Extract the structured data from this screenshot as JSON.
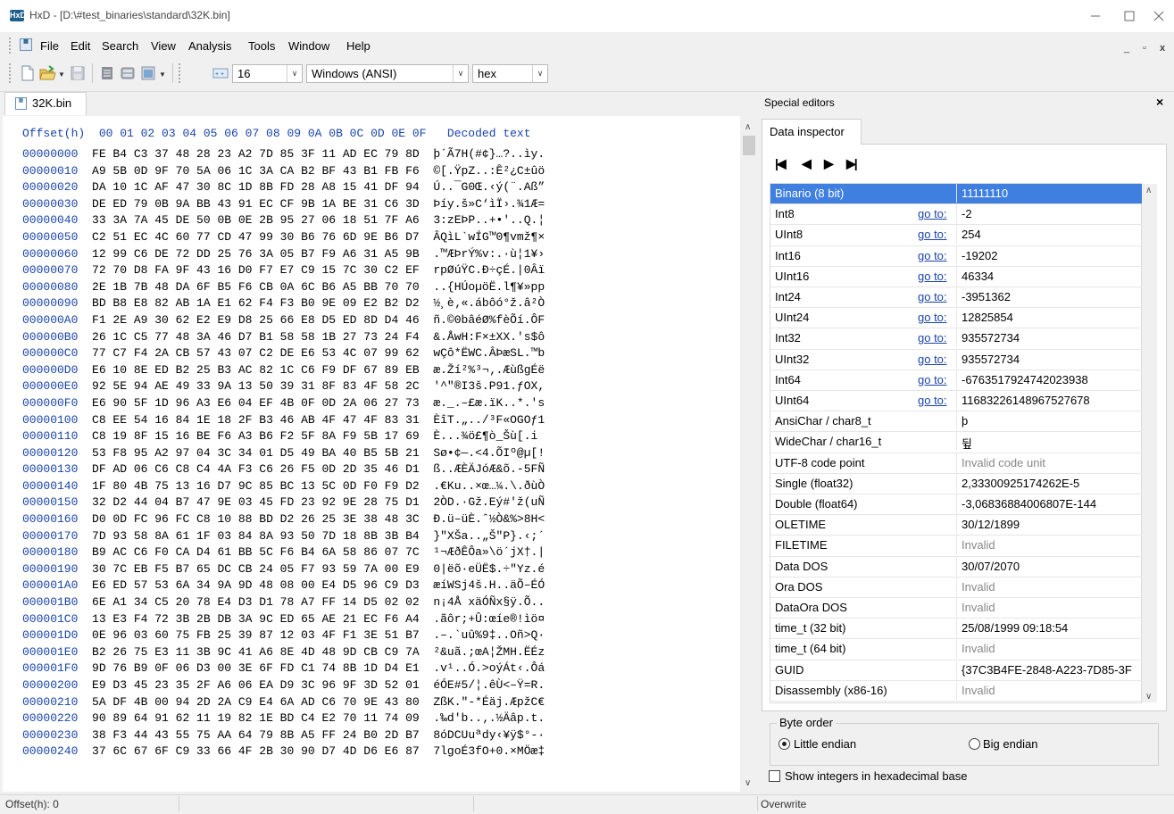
{
  "window": {
    "logo": "HxD",
    "title": "HxD - [D:\\#test_binaries\\standard\\32K.bin]",
    "controls": [
      "minimize-icon",
      "maximize-icon",
      "close-icon"
    ]
  },
  "menu": {
    "items": [
      "File",
      "Edit",
      "Search",
      "View",
      "Analysis",
      "Tools",
      "Window",
      "Help"
    ],
    "mdi_controls": [
      "_",
      "▫",
      "x"
    ]
  },
  "toolbar": {
    "icons": [
      "new-file-icon",
      "open-file-icon",
      "save-icon",
      "hex-view-icon",
      "database-icon",
      "windows-icon",
      "offset-base-icon"
    ],
    "bytes_per_row": "16",
    "charset": "Windows (ANSI)",
    "offset_base": "hex"
  },
  "document_tab": {
    "label": "32K.bin"
  },
  "hex": {
    "header_offset": "Offset(h)",
    "header_columns": "00 01 02 03 04 05 06 07 08 09 0A 0B 0C 0D 0E 0F",
    "header_decoded": "Decoded text",
    "rows": [
      {
        "offset": "00000000",
        "bytes": "FE B4 C3 37 48 28 23 A2 7D 85 3F 11 AD EC 79 8D",
        "text": "þ´Ã7H(#¢}…?..ìy."
      },
      {
        "offset": "00000010",
        "bytes": "A9 5B 0D 9F 70 5A 06 1C 3A CA B2 BF 43 B1 FB F6",
        "text": "©[.ŸpZ..:Ê²¿C±ûö"
      },
      {
        "offset": "00000020",
        "bytes": "DA 10 1C AF 47 30 8C 1D 8B FD 28 A8 15 41 DF 94",
        "text": "Ú..¯G0Œ.‹ý(¨.Aß”"
      },
      {
        "offset": "00000030",
        "bytes": "DE ED 79 0B 9A BB 43 91 EC CF 9B 1A BE 31 C6 3D",
        "text": "Þíy.š»C‘ìÏ›.¾1Æ="
      },
      {
        "offset": "00000040",
        "bytes": "33 3A 7A 45 DE 50 0B 0E 2B 95 27 06 18 51 7F A6",
        "text": "3:zEÞP..+•'..Q.¦"
      },
      {
        "offset": "00000050",
        "bytes": "C2 51 EC 4C 60 77 CD 47 99 30 B6 76 6D 9E B6 D7",
        "text": "ÂQìL`wÍG™0¶vmž¶×"
      },
      {
        "offset": "00000060",
        "bytes": "12 99 C6 DE 72 DD 25 76 3A 05 B7 F9 A6 31 A5 9B",
        "text": ".™ÆÞrÝ%v:.·ù¦1¥›"
      },
      {
        "offset": "00000070",
        "bytes": "72 70 D8 FA 9F 43 16 D0 F7 E7 C9 15 7C 30 C2 EF",
        "text": "rpØúŸC.Ð÷çÉ.|0Âï"
      },
      {
        "offset": "00000080",
        "bytes": "2E 1B 7B 48 DA 6F B5 F6 CB 0A 6C B6 A5 BB 70 70",
        "text": "..{HÚoµöË.l¶¥»pp"
      },
      {
        "offset": "00000090",
        "bytes": "BD B8 E8 82 AB 1A E1 62 F4 F3 B0 9E 09 E2 B2 D2",
        "text": "½¸è‚«.ábôó°ž.â²Ò"
      },
      {
        "offset": "000000A0",
        "bytes": "F1 2E A9 30 62 E2 E9 D8 25 66 E8 D5 ED 8D D4 46",
        "text": "ñ.©0bâéØ%fèÕí.ÔF"
      },
      {
        "offset": "000000B0",
        "bytes": "26 1C C5 77 48 3A 46 D7 B1 58 58 1B 27 73 24 F4",
        "text": "&.ÅwH:F×±XX.'s$ô"
      },
      {
        "offset": "000000C0",
        "bytes": "77 C7 F4 2A CB 57 43 07 C2 DE E6 53 4C 07 99 62",
        "text": "wÇô*ËWC.ÂÞæSL.™b"
      },
      {
        "offset": "000000D0",
        "bytes": "E6 10 8E ED B2 25 B3 AC 82 1C C6 F9 DF 67 89 EB",
        "text": "æ.Ží²%³¬‚.ÆùßgÉë"
      },
      {
        "offset": "000000E0",
        "bytes": "92 5E 94 AE 49 33 9A 13 50 39 31 8F 83 4F 58 2C",
        "text": "'^\"®I3š.P91.ƒOX,"
      },
      {
        "offset": "000000F0",
        "bytes": "E6 90 5F 1D 96 A3 E6 04 EF 4B 0F 0D 2A 06 27 73",
        "text": "æ._.–£æ.ïK..*.'s"
      },
      {
        "offset": "00000100",
        "bytes": "C8 EE 54 16 84 1E 18 2F B3 46 AB 4F 47 4F 83 31",
        "text": "ÈîT.„../³F«OGOƒ1"
      },
      {
        "offset": "00000110",
        "bytes": "C8 19 8F 15 16 BE F6 A3 B6 F2 5F 8A F9 5B 17 69",
        "text": "È...¾ö£¶ò_Šù[.i"
      },
      {
        "offset": "00000120",
        "bytes": "53 F8 95 A2 97 04 3C 34 01 D5 49 BA 40 B5 5B 21",
        "text": "Sø•¢—.<4.ÕIº@µ[!"
      },
      {
        "offset": "00000130",
        "bytes": "DF AD 06 C6 C8 C4 4A F3 C6 26 F5 0D 2D 35 46 D1",
        "text": "ß..ÆÈÄJóÆ&õ.-5FÑ"
      },
      {
        "offset": "00000140",
        "bytes": "1F 80 4B 75 13 16 D7 9C 85 BC 13 5C 0D F0 F9 D2",
        "text": ".€Ku..×œ…¼.\\.ðùÒ"
      },
      {
        "offset": "00000150",
        "bytes": "32 D2 44 04 B7 47 9E 03 45 FD 23 92 9E 28 75 D1",
        "text": "2ÒD.·Gž.Eý#'ž(uÑ"
      },
      {
        "offset": "00000160",
        "bytes": "D0 0D FC 96 FC C8 10 88 BD D2 26 25 3E 38 48 3C",
        "text": "Ð.ü–üÈ.ˆ½Ò&%>8H<"
      },
      {
        "offset": "00000170",
        "bytes": "7D 93 58 8A 61 1F 03 84 8A 93 50 7D 18 8B 3B B4",
        "text": "}\"XŠa..„Š\"P}.‹;´"
      },
      {
        "offset": "00000180",
        "bytes": "B9 AC C6 F0 CA D4 61 BB 5C F6 B4 6A 58 86 07 7C",
        "text": "¹¬ÆðÊÔa»\\ö´jX†.|"
      },
      {
        "offset": "00000190",
        "bytes": "30 7C EB F5 B7 65 DC CB 24 05 F7 93 59 7A 00 E9",
        "text": "0|ëõ·eÜË$.÷\"Yz.é"
      },
      {
        "offset": "000001A0",
        "bytes": "E6 ED 57 53 6A 34 9A 9D 48 08 00 E4 D5 96 C9 D3",
        "text": "æíWSj4š.H..äÕ–ÉÓ"
      },
      {
        "offset": "000001B0",
        "bytes": "6E A1 34 C5 20 78 E4 D3 D1 78 A7 FF 14 D5 02 02",
        "text": "n¡4Å xäÓÑx§ÿ.Õ.."
      },
      {
        "offset": "000001C0",
        "bytes": "13 E3 F4 72 3B 2B DB 3A 9C ED 65 AE 21 EC F6 A4",
        "text": ".ãôr;+Û:œíe®!ìö¤"
      },
      {
        "offset": "000001D0",
        "bytes": "0E 96 03 60 75 FB 25 39 87 12 03 4F F1 3E 51 B7",
        "text": ".–.`uû%9‡..Oñ>Q·"
      },
      {
        "offset": "000001E0",
        "bytes": "B2 26 75 E3 11 3B 9C 41 A6 8E 4D 48 9D CB C9 7A",
        "text": "²&uã.;œA¦ŽMH.ËÉz"
      },
      {
        "offset": "000001F0",
        "bytes": "9D 76 B9 0F 06 D3 00 3E 6F FD C1 74 8B 1D D4 E1",
        "text": ".v¹..Ó.>oýÁt‹.Ôá"
      },
      {
        "offset": "00000200",
        "bytes": "E9 D3 45 23 35 2F A6 06 EA D9 3C 96 9F 3D 52 01",
        "text": "éÓE#5/¦.êÙ<–Ÿ=R."
      },
      {
        "offset": "00000210",
        "bytes": "5A DF 4B 00 94 2D 2A C9 E4 6A AD C6 70 9E 43 80",
        "text": "ZßK.\"-*Éäj.ÆpžC€"
      },
      {
        "offset": "00000220",
        "bytes": "90 89 64 91 62 11 19 82 1E BD C4 E2 70 11 74 09",
        "text": ".‰d'b..‚.½Äâp.t."
      },
      {
        "offset": "00000230",
        "bytes": "38 F3 44 43 55 75 AA 64 79 8B A5 FF 24 B0 2D B7",
        "text": "8óDCUuªdy‹¥ÿ$°-·"
      },
      {
        "offset": "00000240",
        "bytes": "37 6C 67 6F C9 33 66 4F 2B 30 90 D7 4D D6 E6 87",
        "text": "7lgoÉ3fO+0.×MÖæ‡"
      }
    ]
  },
  "status": {
    "offset": "Offset(h): 0",
    "mode": "Overwrite"
  },
  "special_editors": {
    "title": "Special editors",
    "close": "×",
    "tab": "Data inspector",
    "nav": [
      "first-icon",
      "previous-icon",
      "next-icon",
      "last-icon"
    ],
    "goto_label": "go to:",
    "rows": [
      {
        "name": "Binario (8 bit)",
        "value": "11111110",
        "goto": false,
        "selected": true
      },
      {
        "name": "Int8",
        "value": "-2",
        "goto": true
      },
      {
        "name": "UInt8",
        "value": "254",
        "goto": true
      },
      {
        "name": "Int16",
        "value": "-19202",
        "goto": true
      },
      {
        "name": "UInt16",
        "value": "46334",
        "goto": true
      },
      {
        "name": "Int24",
        "value": "-3951362",
        "goto": true
      },
      {
        "name": "UInt24",
        "value": "12825854",
        "goto": true
      },
      {
        "name": "Int32",
        "value": "935572734",
        "goto": true
      },
      {
        "name": "UInt32",
        "value": "935572734",
        "goto": true
      },
      {
        "name": "Int64",
        "value": "-6763517924742023938",
        "goto": true
      },
      {
        "name": "UInt64",
        "value": "11683226148967527678",
        "goto": true
      },
      {
        "name": "AnsiChar / char8_t",
        "value": "þ",
        "goto": false
      },
      {
        "name": "WideChar / char16_t",
        "value": "뒾",
        "goto": false
      },
      {
        "name": "UTF-8 code point",
        "value": "Invalid code unit",
        "goto": false,
        "invalid": true
      },
      {
        "name": "Single (float32)",
        "value": "2,33300925174262E-5",
        "goto": false
      },
      {
        "name": "Double (float64)",
        "value": "-3,06836884006807E-144",
        "goto": false
      },
      {
        "name": "OLETIME",
        "value": "30/12/1899",
        "goto": false
      },
      {
        "name": "FILETIME",
        "value": "Invalid",
        "goto": false,
        "invalid": true
      },
      {
        "name": "Data DOS",
        "value": "30/07/2070",
        "goto": false
      },
      {
        "name": "Ora DOS",
        "value": "Invalid",
        "goto": false,
        "invalid": true
      },
      {
        "name": "DataOra DOS",
        "value": "Invalid",
        "goto": false,
        "invalid": true
      },
      {
        "name": "time_t (32 bit)",
        "value": "25/08/1999 09:18:54",
        "goto": false
      },
      {
        "name": "time_t (64 bit)",
        "value": "Invalid",
        "goto": false,
        "invalid": true
      },
      {
        "name": "GUID",
        "value": "{37C3B4FE-2848-A223-7D85-3F",
        "goto": false
      },
      {
        "name": "Disassembly (x86-16)",
        "value": "Invalid",
        "goto": false,
        "invalid": true
      }
    ],
    "byte_order": {
      "label": "Byte order",
      "little": "Little endian",
      "big": "Big endian",
      "selected": "little"
    },
    "hex_checkbox": {
      "label": "Show integers in hexadecimal base",
      "checked": false
    }
  }
}
